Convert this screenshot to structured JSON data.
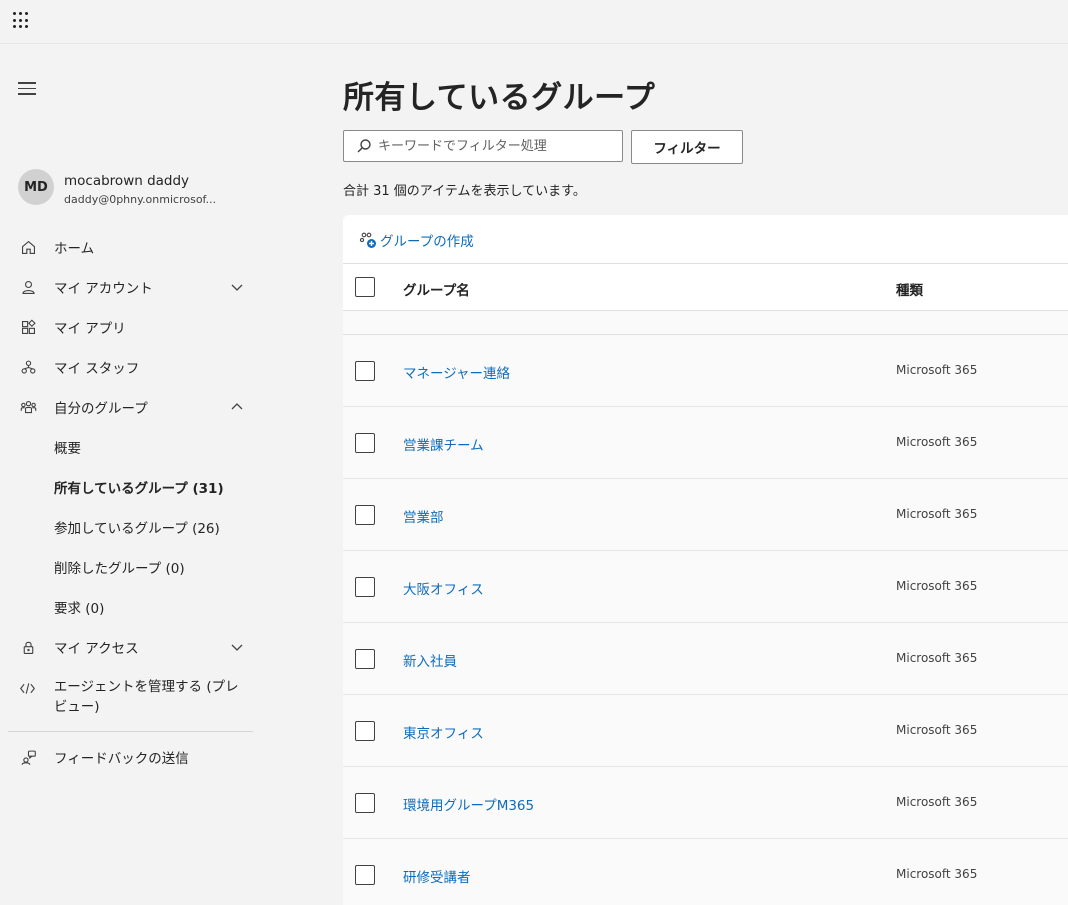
{
  "topbar": {
    "app_launcher_icon": "waffle-icon"
  },
  "sidebar": {
    "menu_icon": "hamburger-icon",
    "profile": {
      "initials": "MD",
      "name": "mocabrown daddy",
      "email": "daddy@0phny.onmicrosof..."
    },
    "items": [
      {
        "label": "ホーム",
        "icon": "home-icon"
      },
      {
        "label": "マイ アカウント",
        "icon": "person-icon",
        "expander": "chevron-down"
      },
      {
        "label": "マイ アプリ",
        "icon": "apps-icon"
      },
      {
        "label": "マイ スタッフ",
        "icon": "people-org-icon"
      },
      {
        "label": "自分のグループ",
        "icon": "people-team-icon",
        "expander": "chevron-up"
      },
      {
        "label": "マイ アクセス",
        "icon": "lock-icon",
        "expander": "chevron-down"
      },
      {
        "label": "エージェントを管理する (プレビュー)",
        "icon": "code-icon"
      },
      {
        "label": "フィードバックの送信",
        "icon": "feedback-icon"
      }
    ],
    "group_subitems": [
      {
        "label": "概要"
      },
      {
        "label": "所有しているグループ (31)",
        "active": true
      },
      {
        "label": "参加しているグループ (26)"
      },
      {
        "label": "削除したグループ (0)"
      },
      {
        "label": "要求 (0)"
      }
    ]
  },
  "main": {
    "title": "所有しているグループ",
    "search_placeholder": "キーワードでフィルター処理",
    "filter_button": "フィルター",
    "count_text": "合計 31 個のアイテムを表示しています。",
    "create_group": "グループの作成",
    "columns": {
      "name": "グループ名",
      "type": "種類"
    },
    "rows": [
      {
        "name": "マネージャー連絡",
        "type": "Microsoft 365"
      },
      {
        "name": "営業課チーム",
        "type": "Microsoft 365"
      },
      {
        "name": "営業部",
        "type": "Microsoft 365"
      },
      {
        "name": "大阪オフィス",
        "type": "Microsoft 365"
      },
      {
        "name": "新入社員",
        "type": "Microsoft 365"
      },
      {
        "name": "東京オフィス",
        "type": "Microsoft 365"
      },
      {
        "name": "環境用グループM365",
        "type": "Microsoft 365"
      },
      {
        "name": "研修受講者",
        "type": "Microsoft 365"
      }
    ]
  },
  "colors": {
    "link": "#0f6cbd",
    "background": "#f3f3f3",
    "card": "#ffffff"
  }
}
